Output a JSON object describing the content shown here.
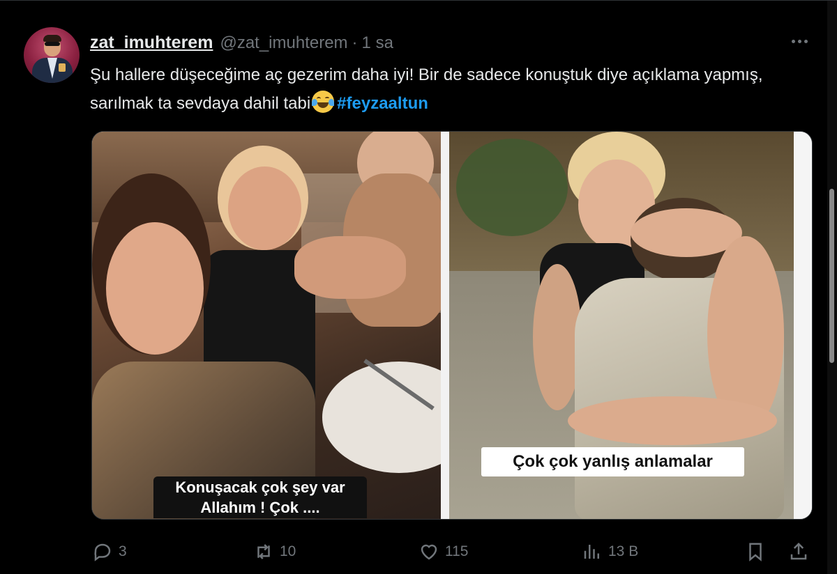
{
  "tweet": {
    "display_name": "zat_imuhterem",
    "handle": "@zat_imuhterem",
    "separator": "·",
    "time": "1 sa",
    "text_part1": "Şu hallere düşeceğime aç gezerim daha iyi! Bir de sadece konuştuk diye açıklama yapmış, sarılmak ta sevdaya dahil tabi",
    "emoji": "face-with-tears-of-joy",
    "hashtag": "#feyzaaltun"
  },
  "media": {
    "left_caption_line1": "Konuşacak çok şey var",
    "left_caption_line2": "Allahım ! Çok ....",
    "right_caption": "Çok çok yanlış anlamalar"
  },
  "actions": {
    "replies": "3",
    "retweets": "10",
    "likes": "115",
    "views": "13 B"
  },
  "colors": {
    "background": "#000000",
    "text": "#e7e9ea",
    "muted": "#71767b",
    "link": "#1d9bf0"
  }
}
